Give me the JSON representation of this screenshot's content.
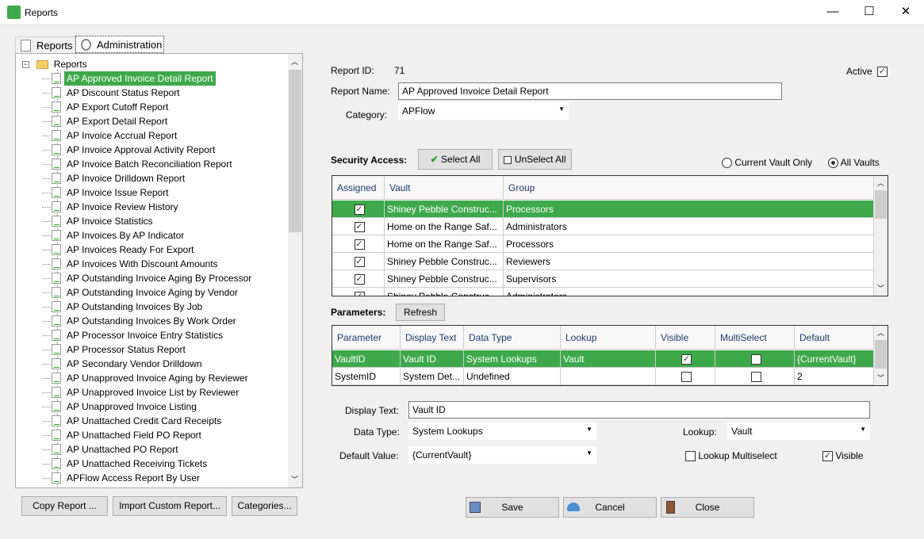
{
  "window": {
    "title": "Reports",
    "minimize": "—",
    "maximize": "☐",
    "close": "✕"
  },
  "tabs": [
    {
      "label": "Reports"
    },
    {
      "label": "Administration"
    }
  ],
  "tree": {
    "root": "Reports",
    "items": [
      "AP Approved Invoice Detail Report",
      "AP Discount Status Report",
      "AP Export Cutoff Report",
      "AP Export Detail Report",
      "AP Invoice Accrual Report",
      "AP Invoice Approval Activity Report",
      "AP Invoice Batch Reconciliation Report",
      "AP Invoice Drilldown Report",
      "AP Invoice Issue Report",
      "AP Invoice Review History",
      "AP Invoice Statistics",
      "AP Invoices By AP Indicator",
      "AP Invoices Ready For Export",
      "AP Invoices With Discount Amounts",
      "AP Outstanding Invoice Aging By Processor",
      "AP Outstanding Invoice Aging by Vendor",
      "AP Outstanding Invoices By Job",
      "AP Outstanding Invoices By Work Order",
      "AP Processor Invoice Entry Statistics",
      "AP Processor Status Report",
      "AP Secondary Vendor Drilldown",
      "AP Unapproved Invoice Aging by Reviewer",
      "AP Unapproved Invoice List by Reviewer",
      "AP Unapproved Invoice Listing",
      "AP Unattached Credit Card Receipts",
      "AP Unattached Field PO Report",
      "AP Unattached PO Report",
      "AP Unattached Receiving Tickets",
      "APFlow Access Report By User"
    ],
    "selected_index": 0
  },
  "left_buttons": {
    "copy": "Copy Report ...",
    "import": "Import Custom Report...",
    "categories": "Categories..."
  },
  "form": {
    "report_id_label": "Report ID:",
    "report_id": "71",
    "active_label": "Active",
    "active": true,
    "report_name_label": "Report Name:",
    "report_name": "AP Approved Invoice Detail Report",
    "category_label": "Category:",
    "category": "APFlow"
  },
  "security": {
    "label": "Security Access:",
    "select_all": "Select All",
    "unselect_all": "UnSelect All",
    "radio_current": "Current Vault Only",
    "radio_all": "All Vaults",
    "selected_radio": "All Vaults",
    "columns": [
      "Assigned",
      "Vault",
      "Group"
    ],
    "rows": [
      {
        "assigned": true,
        "vault": "Shiney Pebble Construc...",
        "group": "Processors"
      },
      {
        "assigned": true,
        "vault": "Home on the Range Saf...",
        "group": "Administrators"
      },
      {
        "assigned": true,
        "vault": "Home on the Range Saf...",
        "group": "Processors"
      },
      {
        "assigned": true,
        "vault": "Shiney Pebble Construc...",
        "group": "Reviewers"
      },
      {
        "assigned": true,
        "vault": "Shiney Pebble Construc...",
        "group": "Supervisors"
      },
      {
        "assigned": true,
        "vault": "Shiney Pebble Construc...",
        "group": "Administrators"
      }
    ]
  },
  "parameters": {
    "label": "Parameters:",
    "refresh": "Refresh",
    "columns": [
      "Parameter",
      "Display Text",
      "Data Type",
      "Lookup",
      "Visible",
      "MultiSelect",
      "Default"
    ],
    "rows": [
      {
        "parameter": "VaultID",
        "display_text": "Vault ID",
        "data_type": "System Lookups",
        "lookup": "Vault",
        "visible": true,
        "multiselect": false,
        "default": "{CurrentVault}"
      },
      {
        "parameter": "SystemID",
        "display_text": "System Det...",
        "data_type": "Undefined",
        "lookup": "",
        "visible": false,
        "multiselect": false,
        "default": "2"
      }
    ]
  },
  "detail": {
    "display_text_label": "Display Text:",
    "display_text": "Vault ID",
    "data_type_label": "Data Type:",
    "data_type": "System Lookups",
    "lookup_label": "Lookup:",
    "lookup": "Vault",
    "default_label": "Default Value:",
    "default": "{CurrentVault}",
    "lookup_multiselect_label": "Lookup Multiselect",
    "lookup_multiselect": false,
    "visible_label": "Visible",
    "visible": true
  },
  "actions": {
    "save": "Save",
    "cancel": "Cancel",
    "close": "Close"
  },
  "colors": {
    "selection": "#3ea94b"
  }
}
